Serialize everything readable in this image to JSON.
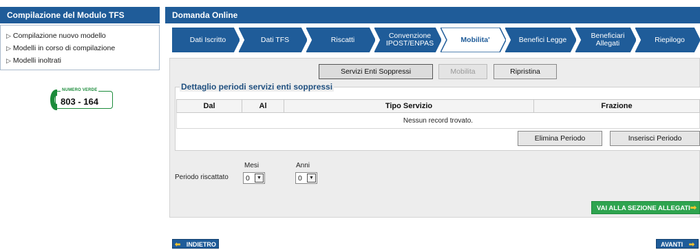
{
  "sidebar": {
    "title": "Compilazione del Modulo TFS",
    "items": [
      {
        "label": "Compilazione nuovo modello"
      },
      {
        "label": "Modelli in corso di compilazione"
      },
      {
        "label": "Modelli inoltrati"
      }
    ],
    "numero_verde": {
      "caption": "NUMERO VERDE",
      "number": "803 - 164",
      "icon": "phone-icon"
    }
  },
  "main": {
    "title": "Domanda Online",
    "steps": [
      {
        "label": "Dati Iscritto",
        "active": false
      },
      {
        "label": "Dati TFS",
        "active": false
      },
      {
        "label": "Riscatti",
        "active": false
      },
      {
        "label": "Convenzione IPOST/ENPAS",
        "active": false
      },
      {
        "label": "Mobilita'",
        "active": true
      },
      {
        "label": "Benefici Legge",
        "active": false
      },
      {
        "label": "Beneficiari Allegati",
        "active": false
      },
      {
        "label": "Riepilogo",
        "active": false
      }
    ]
  },
  "toolbar": {
    "servizi_label": "Servizi Enti Soppressi",
    "mobilita_label": "Mobilita",
    "ripristina_label": "Ripristina"
  },
  "dettaglio": {
    "legend": "Dettaglio periodi servizi enti soppressi",
    "columns": [
      "Dal",
      "Al",
      "Tipo Servizio",
      "Frazione"
    ],
    "empty_message": "Nessun record trovato.",
    "elimina_label": "Elimina Periodo",
    "inserisci_label": "Inserisci Periodo"
  },
  "periodo": {
    "label": "Periodo riscattato",
    "mesi_label": "Mesi",
    "anni_label": "Anni",
    "mesi_value": "0",
    "anni_value": "0"
  },
  "allegati_label": "VAI ALLA SEZIONE ALLEGATI",
  "nav": {
    "back_label": "INDIETRO",
    "next_label": "AVANTI"
  },
  "colors": {
    "header_blue": "#1f5c99",
    "active_step": "#ffffff",
    "green": "#2ea44f",
    "accent_yellow": "#f5c330"
  }
}
